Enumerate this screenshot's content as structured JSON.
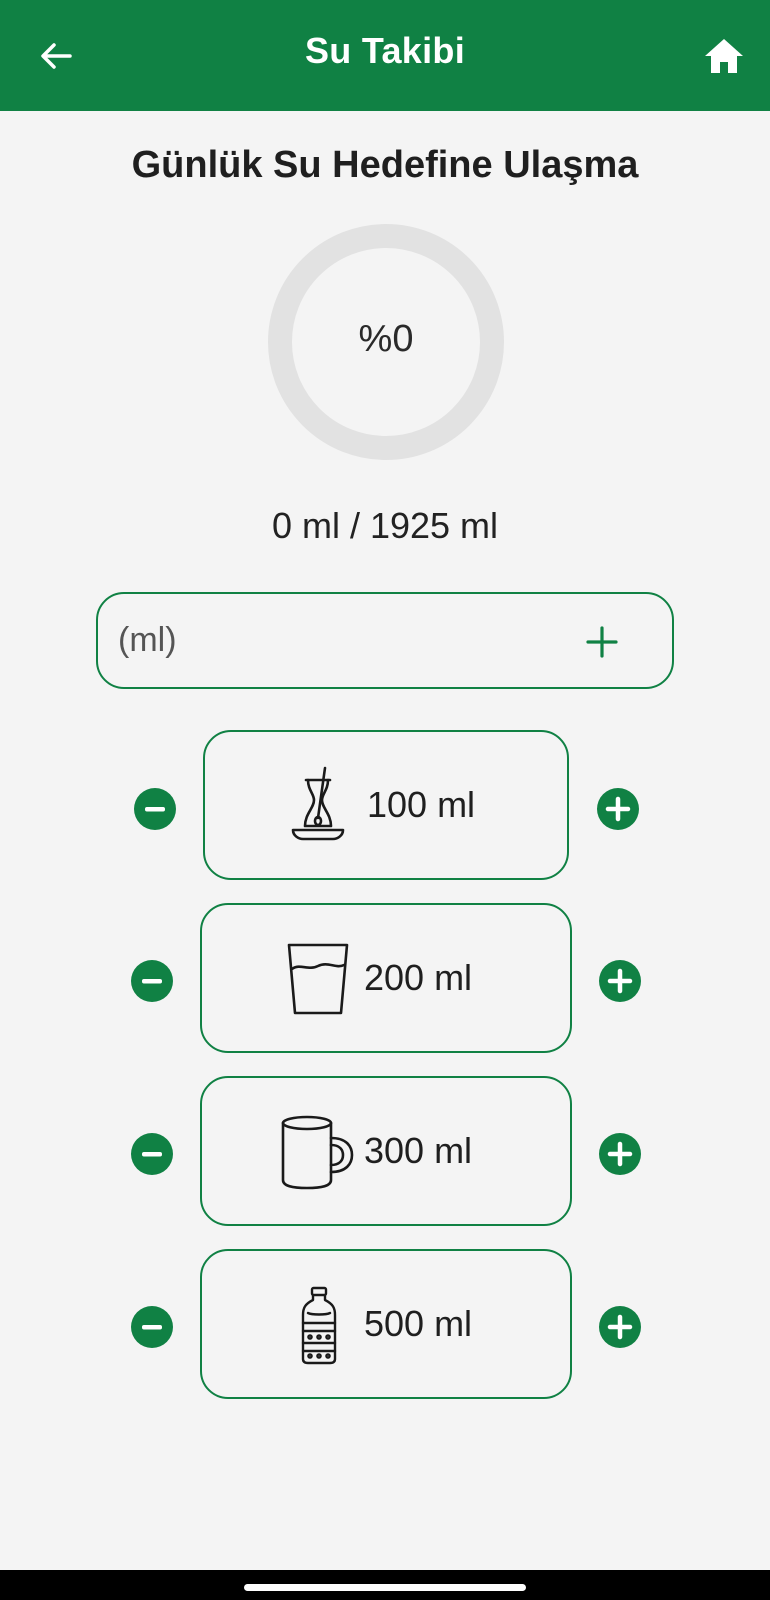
{
  "appbar": {
    "title": "Su Takibi",
    "back_icon": "arrow-left-icon",
    "home_icon": "home-icon"
  },
  "heading": "Günlük Su Hedefine Ulaşma",
  "progress": {
    "percent_label": "%0",
    "percent_value": 0,
    "consumed": "0 ml",
    "goal": "1925 ml",
    "summary": "0 ml / 1925 ml"
  },
  "custom_input": {
    "placeholder": "(ml)",
    "value": "",
    "add_icon": "plus-icon"
  },
  "presets": [
    {
      "icon": "tea-glass-icon",
      "label": "100 ml"
    },
    {
      "icon": "water-glass-icon",
      "label": "200 ml"
    },
    {
      "icon": "mug-icon",
      "label": "300 ml"
    },
    {
      "icon": "water-bottle-icon",
      "label": "500 ml"
    }
  ],
  "colors": {
    "primary": "#108144",
    "background": "#f4f4f4",
    "ring_track": "#e2e2e2"
  }
}
